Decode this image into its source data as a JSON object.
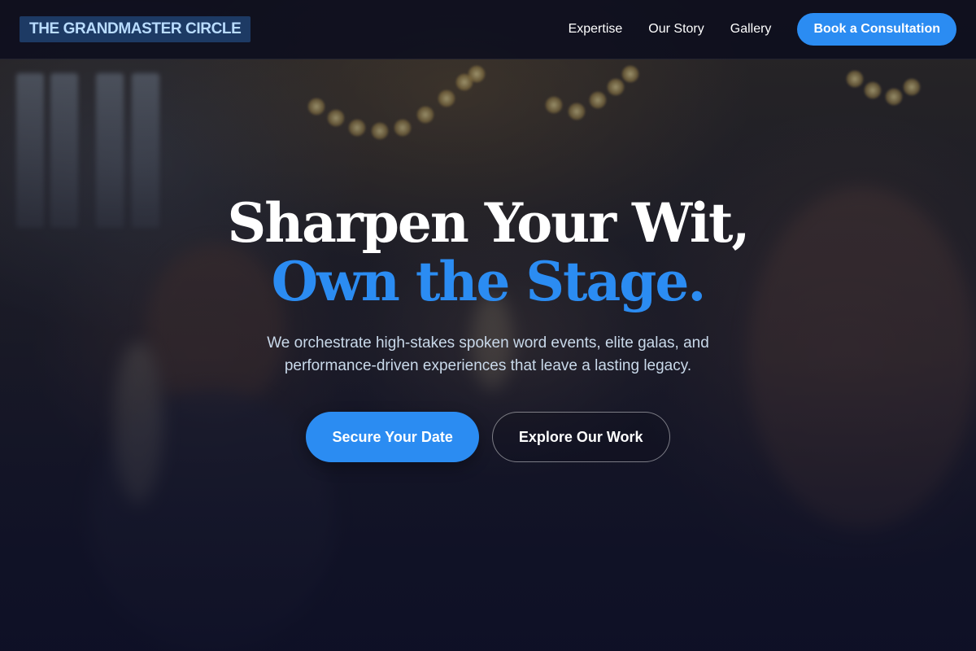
{
  "header": {
    "logo_text": "THE GRANDMASTER CIRCLE",
    "nav": [
      {
        "label": "Expertise"
      },
      {
        "label": "Our Story"
      },
      {
        "label": "Gallery"
      }
    ],
    "cta_label": "Book a Consultation"
  },
  "hero": {
    "headline_line1": "Sharpen Your Wit,",
    "headline_line2": "Own the Stage.",
    "subtitle": "We orchestrate high-stakes spoken word events, elite galas, and performance-driven experiences that leave a lasting legacy.",
    "primary_cta": "Secure Your Date",
    "secondary_cta": "Explore Our Work"
  },
  "colors": {
    "accent": "#2b8cf2",
    "header_bg": "#0c0e1e",
    "logo_bg": "#1d3a64",
    "logo_text": "#b9dcff",
    "subtitle_text": "#c9d9ea"
  }
}
